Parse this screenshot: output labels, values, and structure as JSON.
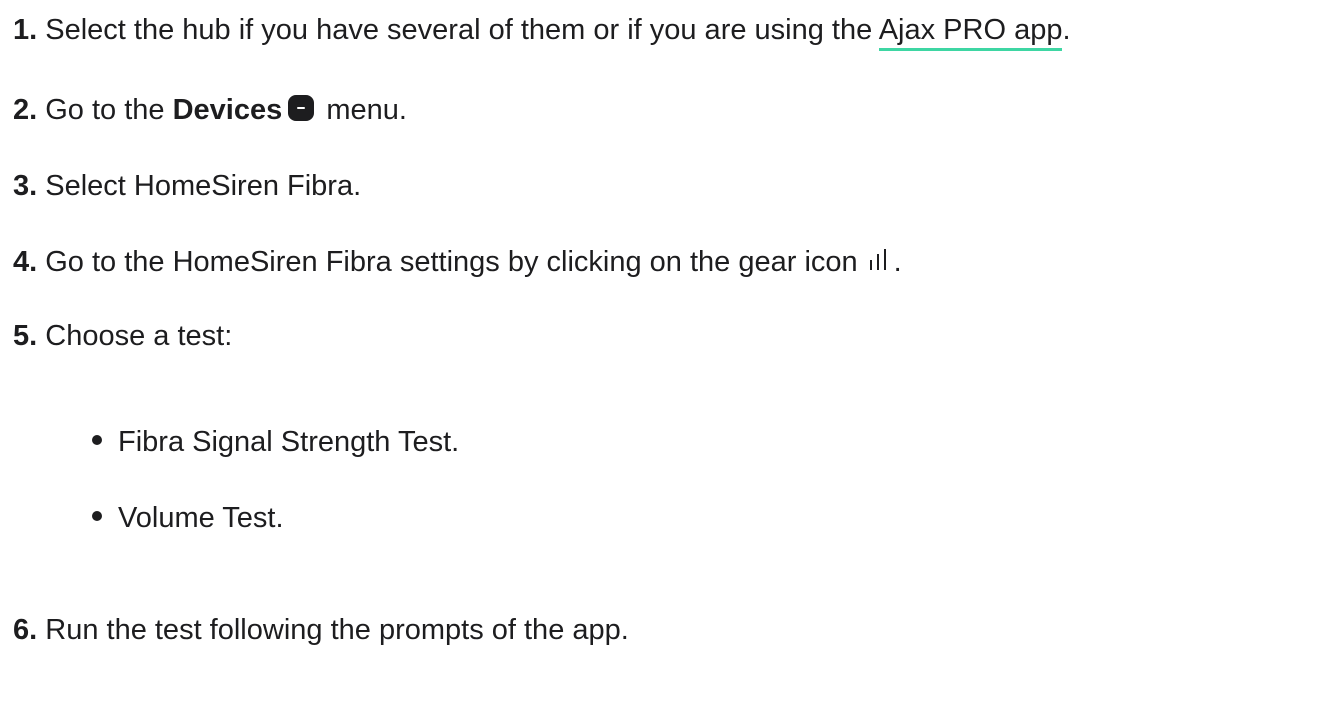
{
  "steps": [
    {
      "num": "1.",
      "text": "Select the hub if you have several of them or if you are using the ",
      "link": "Ajax PRO app",
      "tail": "."
    },
    {
      "num": "2.",
      "pre": "Go to the ",
      "bold": "Devices",
      "post": " menu."
    },
    {
      "num": "3.",
      "text": "Select HomeSiren Fibra."
    },
    {
      "num": "4.",
      "text": "Go to the HomeSiren Fibra settings by clicking on the gear icon",
      "tail": "."
    },
    {
      "num": "5.",
      "text": "Choose a test:"
    },
    {
      "num": "6.",
      "text": "Run the test following the prompts of the app."
    }
  ],
  "tests": [
    "Fibra Signal Strength Test.",
    "Volume Test."
  ],
  "colors": {
    "text": "#1d1d1f",
    "link_underline": "#3ed6a3"
  },
  "icons": {
    "devices": "devices-icon",
    "gear": "gear-icon"
  }
}
